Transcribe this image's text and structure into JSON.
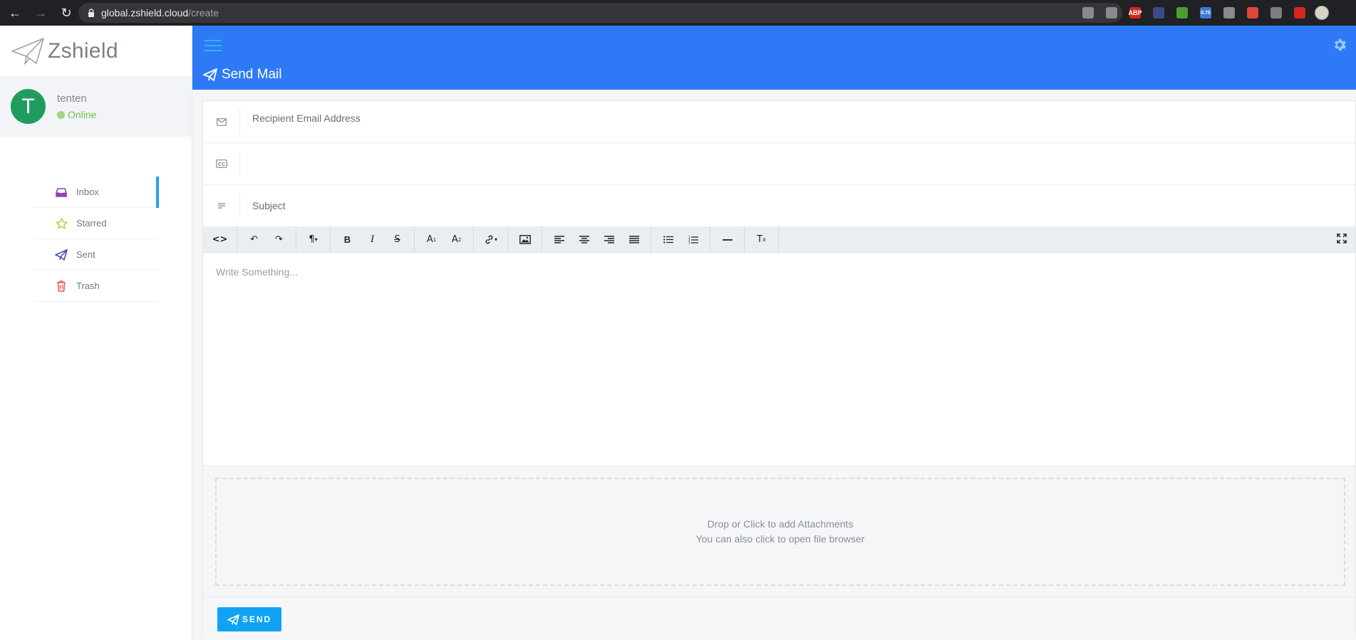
{
  "browser": {
    "url_host": "global.zshield.cloud",
    "url_path": "/create",
    "extensions": [
      {
        "name": "ext-1",
        "color": "#8a8a8a",
        "text": ""
      },
      {
        "name": "ext-2",
        "color": "#8a8a8a",
        "text": ""
      },
      {
        "name": "adblock",
        "color": "#d7261e",
        "text": "ABP"
      },
      {
        "name": "ext-4",
        "color": "#3c4a8a",
        "text": ""
      },
      {
        "name": "ext-5",
        "color": "#4aa02c",
        "text": ""
      },
      {
        "name": "ext-6",
        "color": "#3b7bd6",
        "text": "0.75"
      },
      {
        "name": "ext-7",
        "color": "#8a8a8a",
        "text": ""
      },
      {
        "name": "ext-8",
        "color": "#e0443a",
        "text": ""
      },
      {
        "name": "ext-9",
        "color": "#7b7e83",
        "text": ""
      },
      {
        "name": "ext-10",
        "color": "#d7261e",
        "text": ""
      }
    ]
  },
  "brand": {
    "name": "Zshield"
  },
  "user": {
    "initial": "T",
    "name": "tenten",
    "status": "Online"
  },
  "menu": [
    {
      "label": "Inbox",
      "icon": "inbox-icon",
      "color": "#8e44ad",
      "active": true
    },
    {
      "label": "Starred",
      "icon": "star-icon",
      "color": "#a4d23a",
      "active": false
    },
    {
      "label": "Sent",
      "icon": "paper-plane-icon",
      "color": "#3f51b5",
      "active": false
    },
    {
      "label": "Trash",
      "icon": "trash-icon",
      "color": "#ef5350",
      "active": false
    }
  ],
  "header": {
    "title": "Send Mail"
  },
  "compose": {
    "recipient_placeholder": "Recipient Email Address",
    "cc_placeholder": "",
    "subject_placeholder": "Subject",
    "body_placeholder": "Write Something...",
    "attach_line1": "Drop or Click to add Attachments",
    "attach_line2": "You can also click to open file browser",
    "send_label": "SEND"
  },
  "colors": {
    "header": "#2e7af6",
    "accent": "#10a3f4",
    "online": "#6cc04a"
  }
}
